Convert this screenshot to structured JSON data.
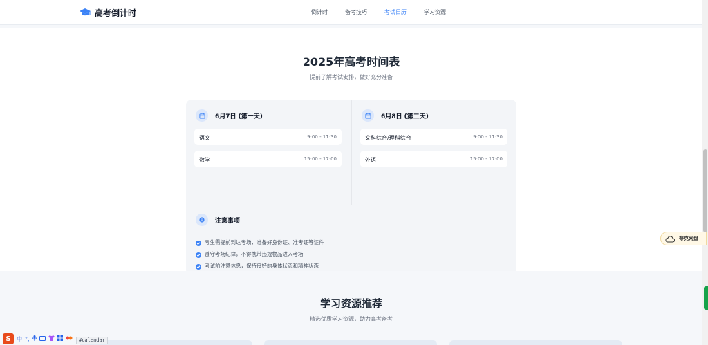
{
  "brand": {
    "title": "高考倒计时",
    "icon": "graduation-cap-icon",
    "color": "#3b82f6"
  },
  "nav": {
    "items": [
      {
        "label": "倒计时",
        "active": false
      },
      {
        "label": "备考技巧",
        "active": false
      },
      {
        "label": "考试日历",
        "active": true
      },
      {
        "label": "学习资源",
        "active": false
      }
    ]
  },
  "schedule": {
    "title": "2025年高考时间表",
    "subtitle": "提前了解考试安排，做好充分准备",
    "days": [
      {
        "label": "6月7日 (第一天)",
        "exams": [
          {
            "subject": "语文",
            "time": "9:00 - 11:30"
          },
          {
            "subject": "数学",
            "time": "15:00 - 17:00"
          }
        ]
      },
      {
        "label": "6月8日 (第二天)",
        "exams": [
          {
            "subject": "文科综合/理科综合",
            "time": "9:00 - 11:30"
          },
          {
            "subject": "外语",
            "time": "15:00 - 17:00"
          }
        ]
      }
    ],
    "notes": {
      "title": "注意事项",
      "items": [
        "考生需提前到达考场，准备好身份证、准考证等证件",
        "遵守考场纪律，不得携带违规物品进入考场",
        "考试前注意休息，保持良好的身体状态和精神状态"
      ]
    }
  },
  "resources": {
    "title": "学习资源推荐",
    "subtitle": "精选优质学习资源，助力高考备考"
  },
  "widget": {
    "label": "夸克网盘",
    "icon": "cloud-icon"
  },
  "ime": {
    "logo": "S",
    "mode": "中"
  },
  "url_fragment": "#calendar",
  "colors": {
    "accent": "#3b82f6",
    "check": "#3b82f6"
  }
}
